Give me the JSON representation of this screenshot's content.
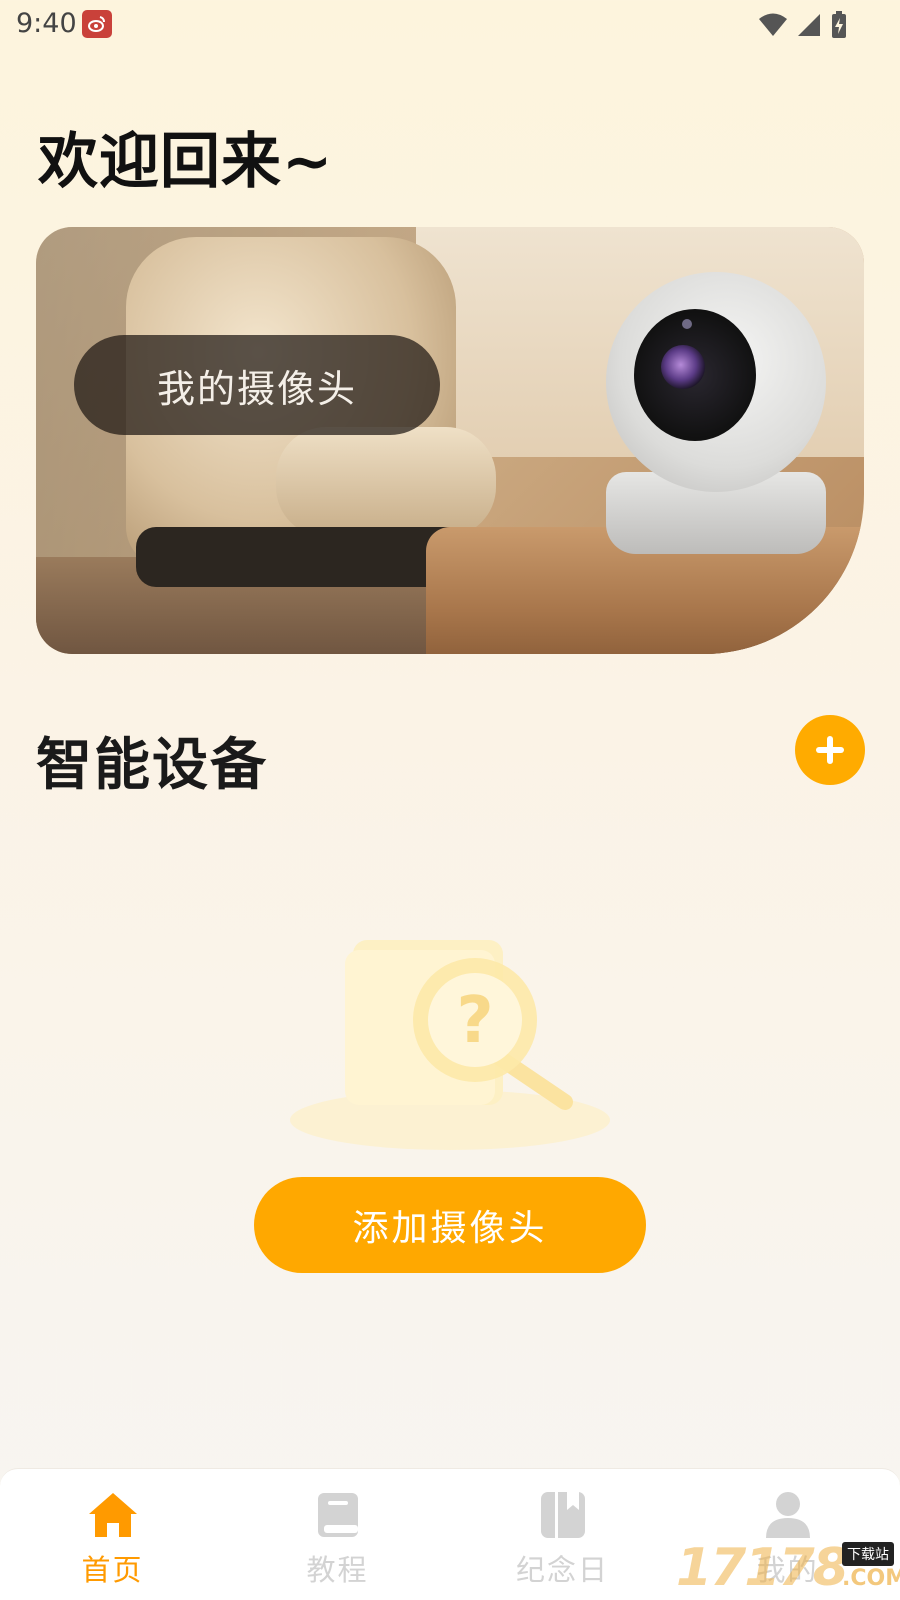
{
  "status_bar": {
    "time": "9:40",
    "icons": [
      "weibo-notification-icon",
      "wifi-icon",
      "signal-icon",
      "battery-charging-icon"
    ]
  },
  "greeting": "欢迎回来~",
  "hero": {
    "label": "我的摄像头"
  },
  "devices_section": {
    "title": "智能设备",
    "add_icon": "plus-icon"
  },
  "empty_state": {
    "illustration": "document-magnifier-question-icon",
    "button_label": "添加摄像头"
  },
  "bottom_nav": {
    "items": [
      {
        "label": "首页",
        "icon": "home-icon",
        "active": true
      },
      {
        "label": "教程",
        "icon": "book-icon",
        "active": false
      },
      {
        "label": "纪念日",
        "icon": "bookmark-book-icon",
        "active": false
      },
      {
        "label": "我的",
        "icon": "user-icon",
        "active": false
      }
    ]
  },
  "watermark": {
    "number": "17178",
    "badge": "下载站",
    "domain": ".COM"
  },
  "colors": {
    "accent": "#ffa800",
    "nav_active": "#ff9a00",
    "nav_inactive": "#d3d3d3"
  }
}
